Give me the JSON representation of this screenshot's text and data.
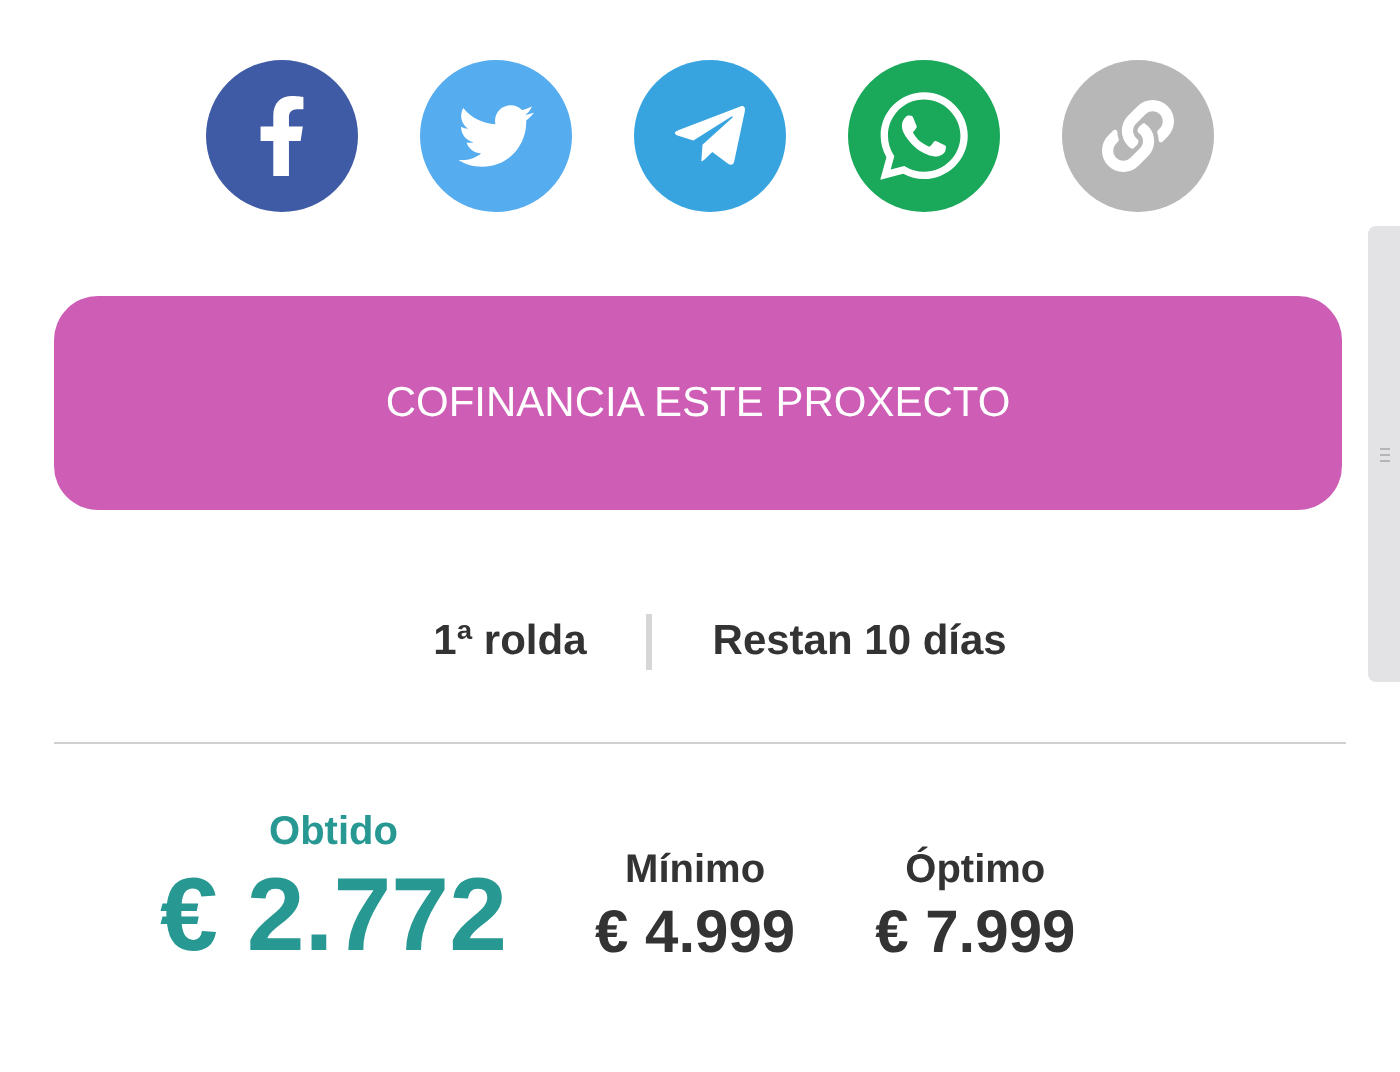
{
  "share_buttons": [
    {
      "kind": "facebook",
      "color": "#3f5ba6"
    },
    {
      "kind": "twitter",
      "color": "#55acee"
    },
    {
      "kind": "telegram",
      "color": "#37a4e0"
    },
    {
      "kind": "whatsapp",
      "color": "#1aa85b"
    },
    {
      "kind": "link",
      "color": "#b7b7b7"
    }
  ],
  "cta": {
    "label": "COFINANCIA ESTE PROXECTO"
  },
  "round": {
    "label": "1ª rolda",
    "remaining": "Restan 10 días"
  },
  "stats": {
    "raised": {
      "label": "Obtido",
      "value": "€ 2.772"
    },
    "targets": [
      {
        "label": "Mínimo",
        "value": "€ 4.999"
      },
      {
        "label": "Óptimo",
        "value": "€ 7.999"
      }
    ]
  }
}
